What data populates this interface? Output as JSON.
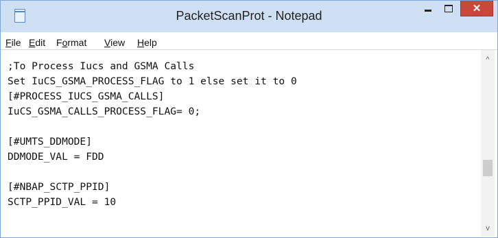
{
  "window": {
    "title": "PacketScanProt - Notepad",
    "controls": {
      "minimize": "–",
      "maximize": "□",
      "close": "✕"
    }
  },
  "menu": [
    {
      "accel": "F",
      "rest": "ile"
    },
    {
      "accel": "E",
      "rest": "dit"
    },
    {
      "pre": "F",
      "accel": "o",
      "rest": "rmat"
    },
    {
      "accel": "V",
      "rest": "iew"
    },
    {
      "accel": "H",
      "rest": "elp"
    }
  ],
  "editor": {
    "lines": [
      ";To Process Iucs and GSMA Calls",
      "Set IuCS_GSMA_PROCESS_FLAG to 1 else set it to 0",
      "[#PROCESS_IUCS_GSMA_CALLS]",
      "IuCS_GSMA_CALLS_PROCESS_FLAG= 0;",
      "",
      "[#UMTS_DDMODE]",
      "DDMODE_VAL = FDD",
      "",
      "[#NBAP_SCTP_PPID]",
      "SCTP_PPID_VAL = 10"
    ]
  },
  "scrollbar": {
    "up": "^",
    "down": "v"
  }
}
